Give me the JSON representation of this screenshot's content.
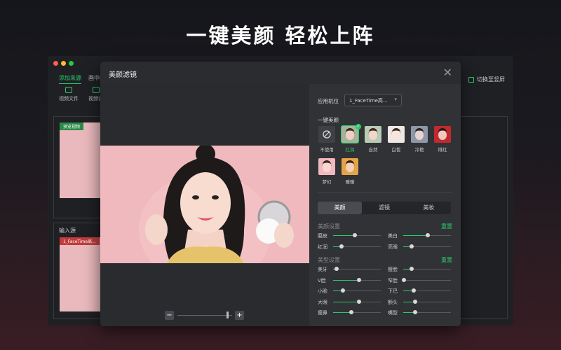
{
  "headline": "一键美颜  轻松上阵",
  "app": {
    "tabs": [
      "添加来源",
      "画中画"
    ],
    "tools": [
      "视频文件",
      "视频设"
    ],
    "preview_tag": "预览视频",
    "input_label": "输入源",
    "input_tag": "1_FaceTime高...",
    "switch_label": "切换至竖屏"
  },
  "dialog": {
    "title": "美颜滤镜",
    "camera_label": "应用机位",
    "camera_value": "1_FaceTime高...",
    "one_click_label": "一键美颜",
    "filters": [
      {
        "label": "不使用",
        "icon": "no-filter-icon"
      },
      {
        "label": "红润",
        "selected": true
      },
      {
        "label": "自然"
      },
      {
        "label": "白皙"
      },
      {
        "label": "冷艳"
      },
      {
        "label": "绯红"
      },
      {
        "label": "梦幻"
      },
      {
        "label": "暖暖"
      }
    ],
    "tabs": [
      "美颜",
      "滤镜",
      "美妆"
    ],
    "active_tab": "美颜",
    "beauty_section": {
      "title": "美颜设置",
      "reset": "重置",
      "sliders": [
        {
          "label": "磨皮",
          "value": 45
        },
        {
          "label": "美白",
          "value": 52
        },
        {
          "label": "红润",
          "value": 18
        },
        {
          "label": "亮眼",
          "value": 18
        }
      ]
    },
    "shape_section": {
      "title": "美型设置",
      "reset": "重置",
      "sliders": [
        {
          "label": "美牙",
          "value": 8
        },
        {
          "label": "瘦脸",
          "value": 18
        },
        {
          "label": "V脸",
          "value": 55
        },
        {
          "label": "窄脸",
          "value": 2
        },
        {
          "label": "小脸",
          "value": 20
        },
        {
          "label": "下巴",
          "value": 22
        },
        {
          "label": "大眼",
          "value": 55
        },
        {
          "label": "额头",
          "value": 25
        },
        {
          "label": "瘦鼻",
          "value": 38
        },
        {
          "label": "嘴型",
          "value": 25
        }
      ]
    },
    "zoom": {
      "minus": "−",
      "plus": "+",
      "value": 90
    }
  },
  "colors": {
    "accent": "#2bc96b"
  }
}
